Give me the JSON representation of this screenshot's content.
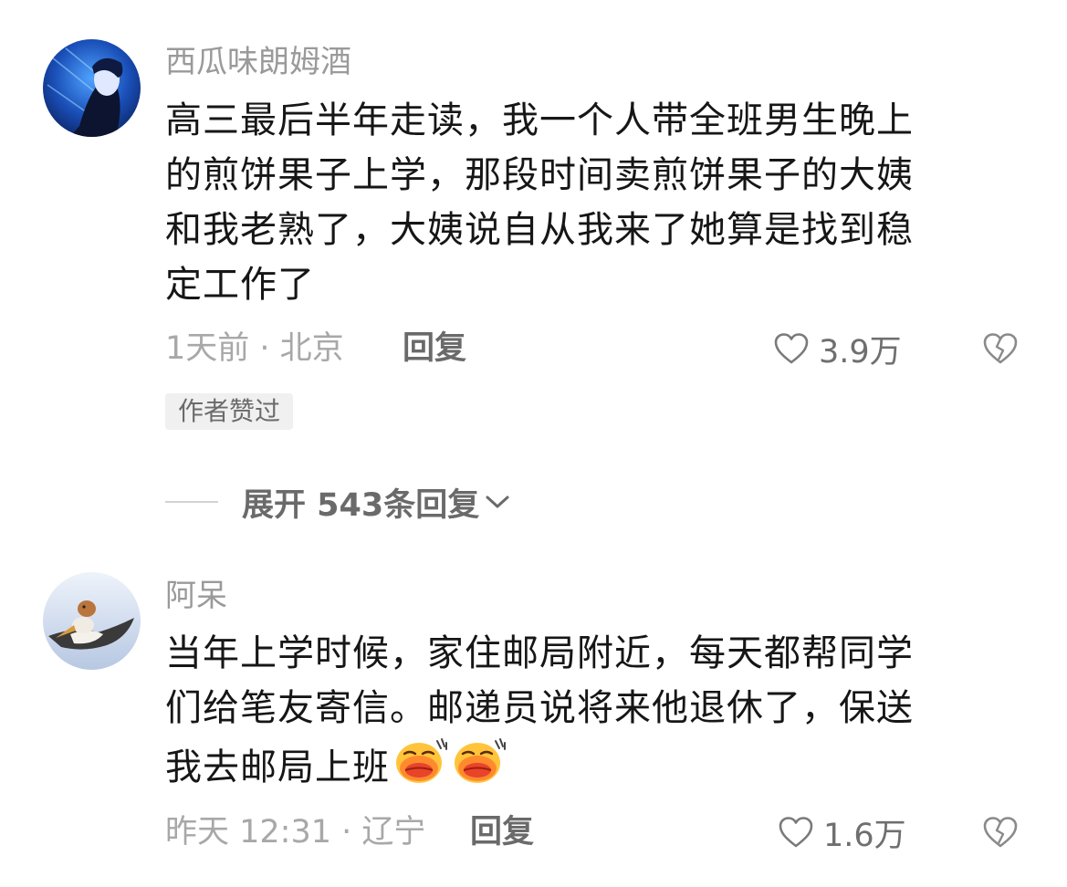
{
  "comments": [
    {
      "username": "西瓜味朗姆酒",
      "text_lines": [
        "高三最后半年走读，我一个人带全班男生晚上",
        "的煎饼果子上学，那段时间卖煎饼果子的大姨",
        "和我老熟了，大姨说自从我来了她算是找到稳",
        "定工作了"
      ],
      "meta": "1天前 · 北京",
      "reply_label": "回复",
      "likes": "3.9万",
      "badge": "作者赞过"
    },
    {
      "username": "阿呆",
      "text_lines": [
        "当年上学时候，家住邮局附近，每天都帮同学",
        "们给笔友寄信。邮递员说将来他退休了，保送",
        "我去邮局上班"
      ],
      "emoji": [
        "kiss-emoji",
        "kiss-emoji"
      ],
      "meta": "昨天 12:31 · 辽宁",
      "reply_label": "回复",
      "likes": "1.6万"
    }
  ],
  "expand_replies": {
    "label": "展开 543条回复"
  },
  "icons": {
    "like": "heart-outline-icon",
    "dislike": "broken-heart-icon",
    "expand": "chevron-down-icon"
  },
  "colors": {
    "username": "#9a9a9a",
    "meta": "#a8a8a8",
    "body": "#161616",
    "badge_bg": "#f0f0f0"
  }
}
